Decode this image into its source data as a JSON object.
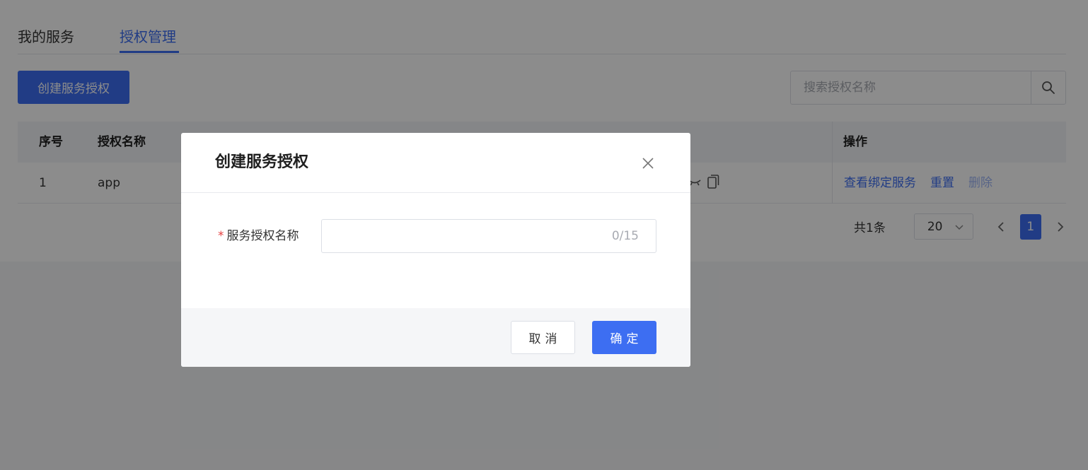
{
  "tabs": [
    {
      "label": "我的服务"
    },
    {
      "label": "授权管理",
      "active": true
    }
  ],
  "toolbar": {
    "create_label": "创建服务授权",
    "search_placeholder": "搜索授权名称"
  },
  "table": {
    "headers": {
      "index": "序号",
      "name": "授权名称",
      "ops": "操作"
    },
    "rows": [
      {
        "index": "1",
        "name": "app",
        "ops": [
          "查看绑定服务",
          "重置",
          "删除"
        ]
      }
    ]
  },
  "pagination": {
    "total": "共1条",
    "page_size": "20",
    "current_page": "1"
  },
  "modal": {
    "title": "创建服务授权",
    "field_required_mark": "*",
    "field_label": "服务授权名称",
    "field_value": "",
    "counter": "0/15",
    "cancel_label": "取消",
    "ok_label": "确定"
  },
  "colors": {
    "primary": "#3d6ef2",
    "required": "#e53e3e",
    "overlay": "rgba(0,0,0,0.45)"
  }
}
